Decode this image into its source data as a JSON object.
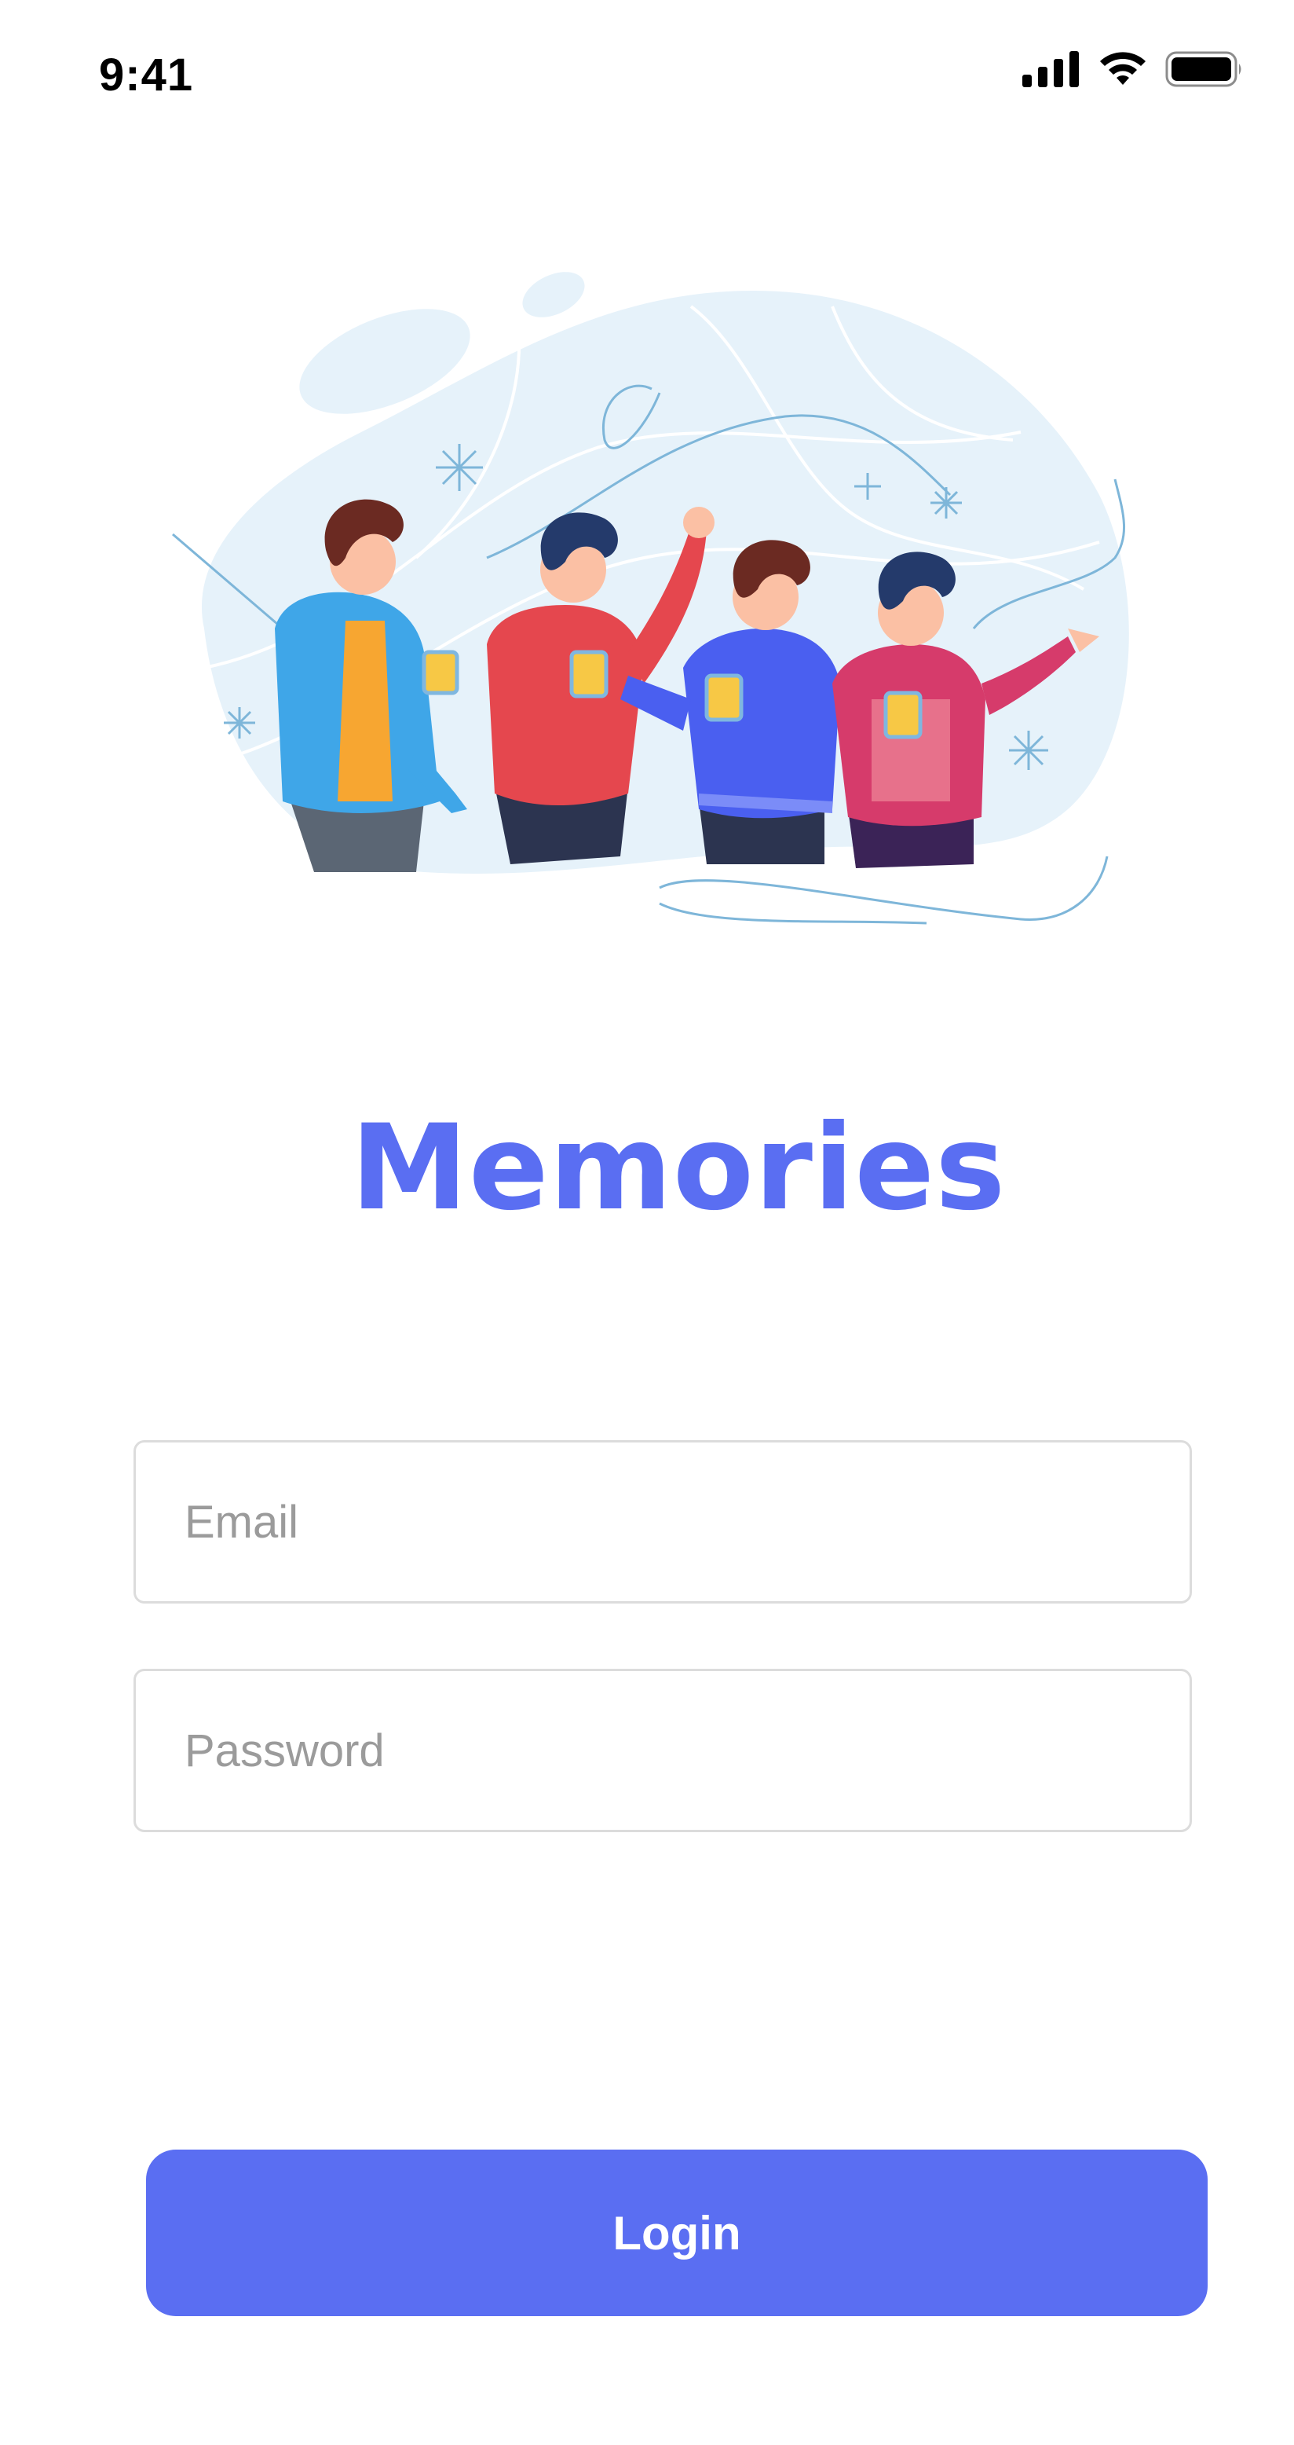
{
  "status_bar": {
    "time": "9:41",
    "icons": [
      "cellular-signal-icon",
      "wifi-icon",
      "battery-icon"
    ]
  },
  "illustration": {
    "description_icon": "friends-cheers-illustration"
  },
  "app": {
    "title": "Memories"
  },
  "form": {
    "email_placeholder": "Email",
    "email_value": "",
    "password_placeholder": "Password",
    "password_value": ""
  },
  "actions": {
    "login_label": "Login"
  },
  "colors": {
    "accent": "#5a6ef2",
    "field_border": "#dcdcdc",
    "placeholder": "#9b9b9b",
    "blob": "#e6f2fa"
  }
}
